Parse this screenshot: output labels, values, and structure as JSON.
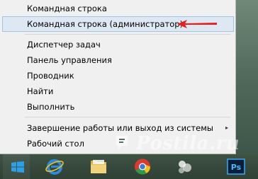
{
  "menu": {
    "items": [
      {
        "label": "Командная строка"
      },
      {
        "label": "Командная строка (администратор)",
        "selected": true
      },
      {
        "label": "Диспетчер задач"
      },
      {
        "label": "Панель управления"
      },
      {
        "label": "Проводник"
      },
      {
        "label": "Найти"
      },
      {
        "label": "Выполнить"
      },
      {
        "label": "Завершение работы или выход из системы",
        "has_submenu": true
      },
      {
        "label": "Рабочий стол"
      }
    ],
    "submenu_arrow_glyph": "▸"
  },
  "annotation": {
    "arrow_color": "#e8201c"
  },
  "taskbar": {
    "items": [
      {
        "icon": "windows-start-icon"
      },
      {
        "icon": "internet-explorer-icon"
      },
      {
        "icon": "file-explorer-icon"
      },
      {
        "icon": "chrome-icon"
      },
      {
        "icon": "app-icon"
      },
      {
        "icon": "photoshop-icon",
        "label": "Ps"
      }
    ]
  },
  "watermark": {
    "text": "Postila.ru"
  },
  "colors": {
    "menu_bg": "#f0f0f0",
    "selection_bg": "#dde8f3",
    "selection_border": "#9ec4e8",
    "taskbar_bg": "#344739"
  }
}
